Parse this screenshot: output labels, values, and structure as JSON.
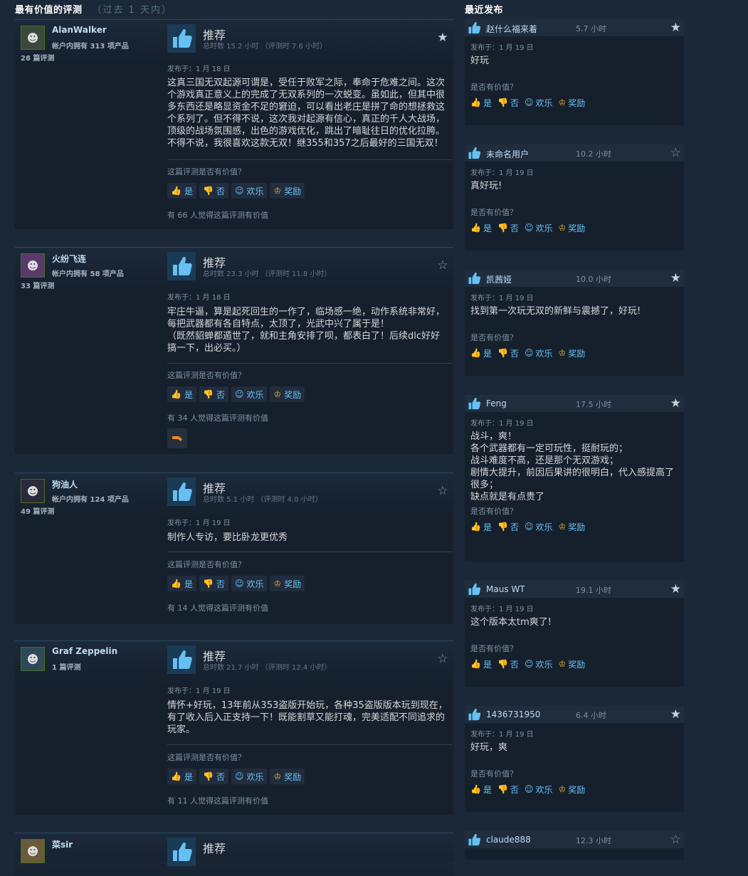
{
  "headers": {
    "most_helpful": "最有价值的评测",
    "most_helpful_range": "（过去 1 天内）",
    "recent": "最近发布"
  },
  "vote_labels": {
    "recommended": "推荐",
    "helpful_question": "这篇评测是否有价值？",
    "yes": "是",
    "no": "否",
    "funny": "欢乐",
    "award": "奖励",
    "recent_question": "是否有价值？"
  },
  "reviews": [
    {
      "author": "AlanWalker",
      "products": "帐户内拥有 313 项产品",
      "review_count": "28 篇评测",
      "vote": "推荐",
      "hours": "总时数 15.2 小时  （评测时 7.6 小时）",
      "posted": "发布于：1 月 18 日",
      "text": "这真三国无双起源可谓是，受任于败军之际，奉命于危难之间。这次个游戏真正意义上的完成了无双系列的一次蜕变。虽如此，但其中很多东西还是略显资金不足的窘迫，可以看出老庄是拼了命的想拯救这个系列了。但不得不说，这次我对起源有信心，真正的千人大战场，顶级的战场氛围感，出色的游戏优化，跳出了暗耻往日的优化拉胯。不得不说，我很喜欢这款无双！继355和357之后最好的三国无双！",
      "helpful_count": "有 66 人觉得这篇评测有价值",
      "starred": true
    },
    {
      "author": "火纷飞连",
      "products": "帐户内拥有 58 项产品",
      "review_count": "33 篇评测",
      "vote": "推荐",
      "hours": "总时数 23.3 小时  （评测时 11.8 小时）",
      "posted": "发布于：1 月 18 日",
      "text": "牢庄牛逼，算是起死回生的一作了，临场感一绝，动作系统非常好，每把武器都有各自特点，太顶了，光武中兴了属于是！\n（既然貂蝉都遁世了，就和主角安排了呗，都表白了！后续dlc好好搞一下，出必买。）",
      "helpful_count": "有 34 人觉得这篇评测有价值",
      "starred": false
    },
    {
      "author": "狗油人",
      "products": "帐户内拥有 124 项产品",
      "review_count": "49 篇评测",
      "vote": "推荐",
      "hours": "总时数 5.1 小时  （评测时 4.0 小时）",
      "posted": "发布于：1 月 19 日",
      "text": "制作人专访，要比卧龙更优秀",
      "helpful_count": "有 14 人觉得这篇评测有价值",
      "starred": false
    },
    {
      "author": "Graf Zeppelin",
      "products": "",
      "review_count": "1 篇评测",
      "vote": "推荐",
      "hours": "总时数 21.7 小时  （评测时 12.4 小时）",
      "posted": "发布于：1 月 19 日",
      "text": "情怀+好玩，13年前从353盗版开始玩，各种35盗版版本玩到现在，有了收入后入正支持一下！既能割草又能打魂，完美适配不同追求的玩家。",
      "helpful_count": "有 11 人觉得这篇评测有价值",
      "starred": false
    },
    {
      "author": "菜sir",
      "vote": "推荐"
    }
  ],
  "recent": [
    {
      "name": "赵什么福来着",
      "hours": "5.7 小时",
      "posted": "发布于：1 月 19 日",
      "text": "好玩",
      "starred": true
    },
    {
      "name": "未命名用户",
      "hours": "10.2 小时",
      "posted": "发布于：1 月 19 日",
      "text": "真好玩!",
      "starred": false
    },
    {
      "name": "凯茜娅",
      "hours": "10.0 小时",
      "posted": "发布于：1 月 19 日",
      "text": "找到第一次玩无双的新鲜与震撼了，好玩!",
      "starred": true
    },
    {
      "name": "Feng",
      "hours": "17.5 小时",
      "posted": "发布于：1 月 19 日",
      "text": "战斗，爽！\n各个武器都有一定可玩性，挺耐玩的；\n战斗难度不高，还是那个无双游戏；\n剧情大提升，前因后果讲的很明白，代入感提高了很多；\n缺点就是有点贵了",
      "starred": true
    },
    {
      "name": "Maus WT",
      "hours": "19.1 小时",
      "posted": "发布于：1 月 19 日",
      "text": "这个版本太tm爽了!",
      "starred": true
    },
    {
      "name": "1436731950",
      "hours": "6.4 小时",
      "posted": "发布于：1 月 19 日",
      "text": "好玩，爽",
      "starred": true
    },
    {
      "name": "claude888",
      "hours": "12.3 小时",
      "posted": "",
      "text": "",
      "starred": false
    }
  ]
}
